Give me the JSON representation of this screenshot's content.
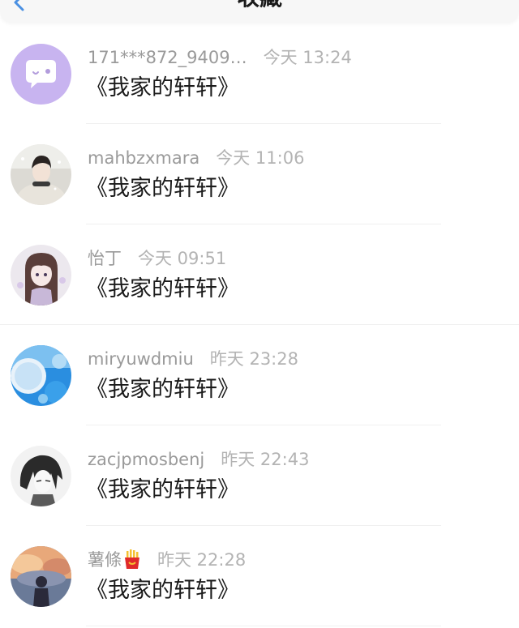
{
  "header": {
    "title": "收藏"
  },
  "items": [
    {
      "name": "171***872_9409…",
      "time": "今天 13:24",
      "title": "《我家的轩轩》",
      "avatar_icon": "chat-bubble-avatar"
    },
    {
      "name": "mahbzxmara",
      "time": "今天 11:06",
      "title": "《我家的轩轩》",
      "avatar_icon": "girl-portrait-avatar"
    },
    {
      "name": "怡丁",
      "time": "今天 09:51",
      "title": "《我家的轩轩》",
      "avatar_icon": "anime-girl-avatar"
    },
    {
      "name": "miryuwdmiu",
      "time": "昨天 23:28",
      "title": "《我家的轩轩》",
      "avatar_icon": "blue-bubbles-avatar"
    },
    {
      "name": "zacjpmosbenj",
      "time": "昨天 22:43",
      "title": "《我家的轩轩》",
      "avatar_icon": "anime-boy-avatar"
    },
    {
      "name": "薯條",
      "time": "昨天 22:28",
      "title": "《我家的轩轩》",
      "avatar_icon": "sunset-figure-avatar",
      "badge_icon": "fries-icon"
    }
  ],
  "colors": {
    "name": "#9a9a9a",
    "time": "#b3b3b3",
    "title": "#1b1b1b",
    "accent": "#4a90e2",
    "avatar_purple": "#c8b4f0"
  }
}
